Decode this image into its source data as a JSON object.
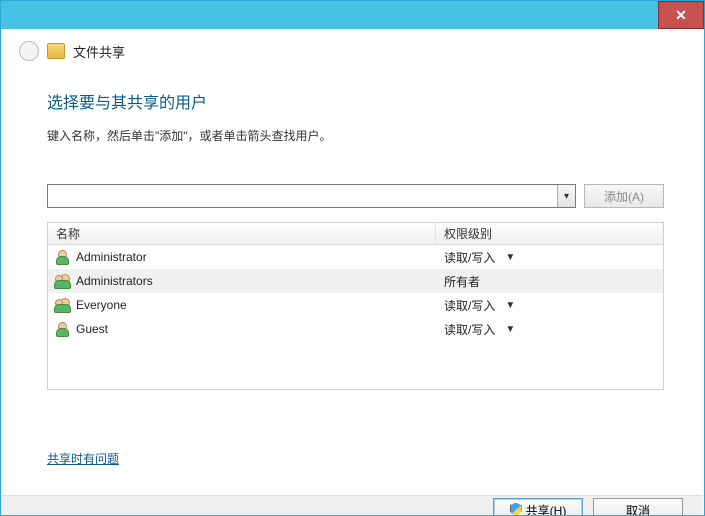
{
  "titlebar": {
    "close": "✕"
  },
  "header": {
    "title": "文件共享"
  },
  "heading": "选择要与其共享的用户",
  "instruction": "键入名称，然后单击\"添加\"，或者单击箭头查找用户。",
  "input": {
    "value": "",
    "add_label": "添加(A)"
  },
  "columns": {
    "name": "名称",
    "perm": "权限级别"
  },
  "rows": [
    {
      "icon": "user",
      "name": "Administrator",
      "perm": "读取/写入",
      "has_dropdown": true,
      "selected": false
    },
    {
      "icon": "group",
      "name": "Administrators",
      "perm": "所有者",
      "has_dropdown": false,
      "selected": true
    },
    {
      "icon": "group",
      "name": "Everyone",
      "perm": "读取/写入",
      "has_dropdown": true,
      "selected": false
    },
    {
      "icon": "user",
      "name": "Guest",
      "perm": "读取/写入",
      "has_dropdown": true,
      "selected": false
    }
  ],
  "help_link": "共享时有问题",
  "footer": {
    "share": "共享(H)",
    "cancel": "取消"
  }
}
